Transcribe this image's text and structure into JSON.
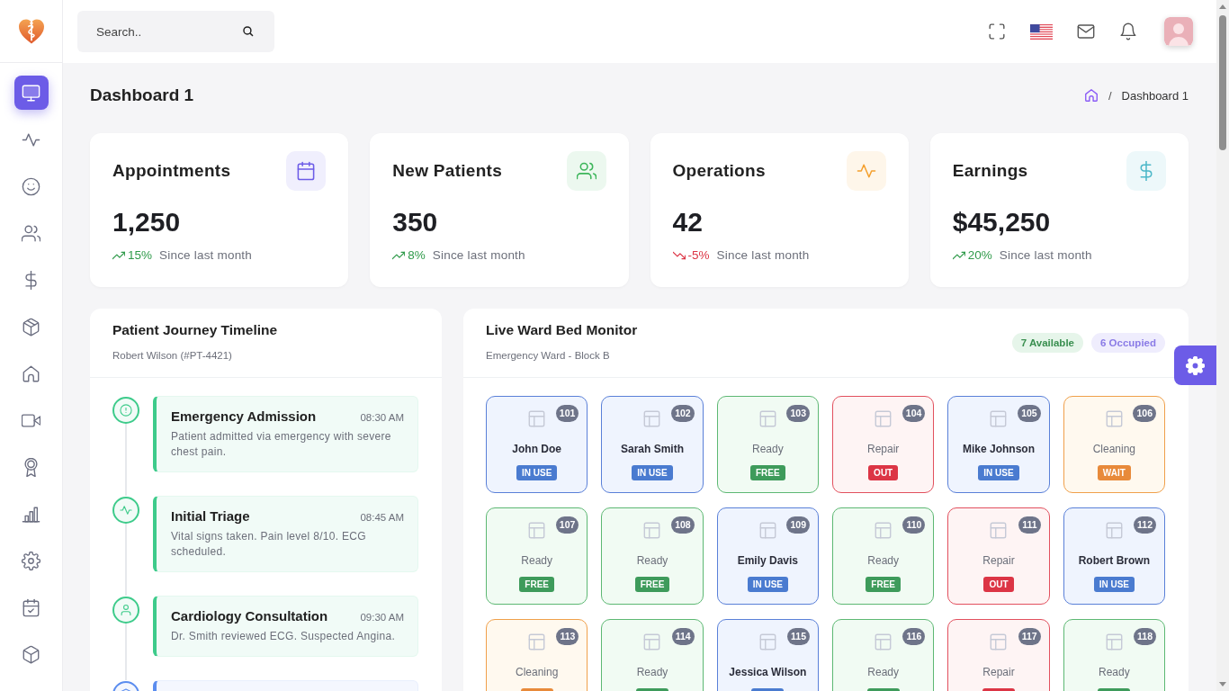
{
  "header": {
    "search": {
      "placeholder": "Search.."
    }
  },
  "sidebar": {
    "items": [
      {
        "selected": true
      },
      {
        "selected": false
      },
      {
        "selected": false
      },
      {
        "selected": false
      },
      {
        "selected": false
      },
      {
        "selected": false
      },
      {
        "selected": false
      },
      {
        "selected": false
      },
      {
        "selected": false
      },
      {
        "selected": false
      },
      {
        "selected": false
      },
      {
        "selected": false
      },
      {
        "selected": false
      }
    ]
  },
  "page": {
    "title": "Dashboard 1",
    "breadcrumb": {
      "separator": "/",
      "current": "Dashboard 1"
    }
  },
  "stats": [
    {
      "title": "Appointments",
      "value": "1,250",
      "change": "15%",
      "kind": "up",
      "note": "Since last month"
    },
    {
      "title": "New Patients",
      "value": "350",
      "change": "8%",
      "kind": "up",
      "note": "Since last month"
    },
    {
      "title": "Operations",
      "value": "42",
      "change": "-5%",
      "kind": "down",
      "note": "Since last month"
    },
    {
      "title": "Earnings",
      "value": "$45,250",
      "change": "20%",
      "kind": "up",
      "note": "Since last month"
    }
  ],
  "timeline": {
    "title": "Patient Journey Timeline",
    "subtitle": "Robert Wilson (#PT-4421)",
    "events": [
      {
        "title": "Emergency Admission",
        "time": "08:30 AM",
        "text": "Patient admitted via emergency with severe chest pain.",
        "color": "#3ecb8b"
      },
      {
        "title": "Initial Triage",
        "time": "08:45 AM",
        "text": "Vital signs taken. Pain level 8/10. ECG scheduled.",
        "color": "#3ecb8b"
      },
      {
        "title": "Cardiology Consultation",
        "time": "09:30 AM",
        "text": "Dr. Smith reviewed ECG. Suspected Angina.",
        "color": "#3ecb8b"
      },
      {
        "color": "#5b8def"
      }
    ]
  },
  "ward": {
    "title": "Live Ward Bed Monitor",
    "subtitle": "Emergency Ward - Block B",
    "counts": [
      {
        "label": "7 Available",
        "kind": "available"
      },
      {
        "label": "6 Occupied",
        "kind": "occupied"
      }
    ],
    "beds": [
      {
        "number": "101",
        "label": "John Doe",
        "kind": "occupied",
        "badge": "IN USE"
      },
      {
        "number": "102",
        "label": "Sarah Smith",
        "kind": "occupied",
        "badge": "IN USE"
      },
      {
        "number": "103",
        "label": "Ready",
        "kind": "free",
        "badge": "FREE"
      },
      {
        "number": "104",
        "label": "Repair",
        "kind": "out",
        "badge": "OUT"
      },
      {
        "number": "105",
        "label": "Mike Johnson",
        "kind": "occupied",
        "badge": "IN USE"
      },
      {
        "number": "106",
        "label": "Cleaning",
        "kind": "wait",
        "badge": "WAIT"
      },
      {
        "number": "107",
        "label": "Ready",
        "kind": "free",
        "badge": "FREE"
      },
      {
        "number": "108",
        "label": "Ready",
        "kind": "free",
        "badge": "FREE"
      },
      {
        "number": "109",
        "label": "Emily Davis",
        "kind": "occupied",
        "badge": "IN USE"
      },
      {
        "number": "110",
        "label": "Ready",
        "kind": "free",
        "badge": "FREE"
      },
      {
        "number": "111",
        "label": "Repair",
        "kind": "out",
        "badge": "OUT"
      },
      {
        "number": "112",
        "label": "Robert Brown",
        "kind": "occupied",
        "badge": "IN USE"
      },
      {
        "number": "113",
        "label": "Cleaning",
        "kind": "wait"
      },
      {
        "number": "114",
        "label": "Ready",
        "kind": "free"
      },
      {
        "number": "115",
        "label": "Jessica Wilson",
        "kind": "occupied"
      },
      {
        "number": "116",
        "label": "Ready",
        "kind": "free"
      },
      {
        "number": "117",
        "label": "Repair",
        "kind": "out"
      },
      {
        "number": "118",
        "label": "Ready",
        "kind": "free"
      }
    ]
  }
}
